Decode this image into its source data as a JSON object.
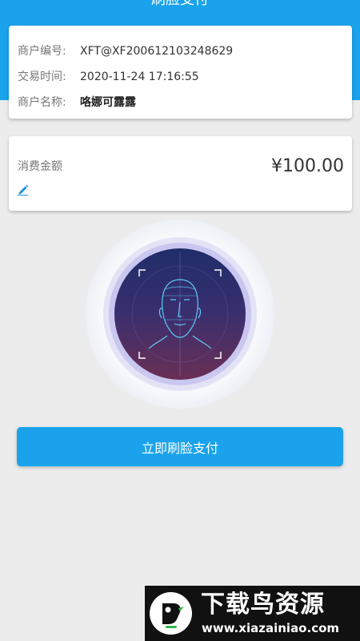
{
  "header": {
    "title": "刷脸支付"
  },
  "merchant": {
    "id_label": "商户编号:",
    "id_value": "XFT@XF200612103248629",
    "time_label": "交易时间:",
    "time_value": "2020-11-24 17:16:55",
    "name_label": "商户名称:",
    "name_value": "咯娜可露露"
  },
  "payment": {
    "amount_label": "消费金额",
    "amount_value": "¥100.00",
    "edit_icon": "pencil-icon"
  },
  "face_scan": {
    "icon": "face-scan-icon"
  },
  "actions": {
    "pay_button": "立即刷脸支付"
  },
  "watermark": {
    "title": "下载鸟资源",
    "url": "www.xiazainiao.com",
    "logo_icon": "bird-logo-icon"
  },
  "colors": {
    "primary": "#1aa3ec",
    "background": "#ececec",
    "card": "#ffffff"
  }
}
